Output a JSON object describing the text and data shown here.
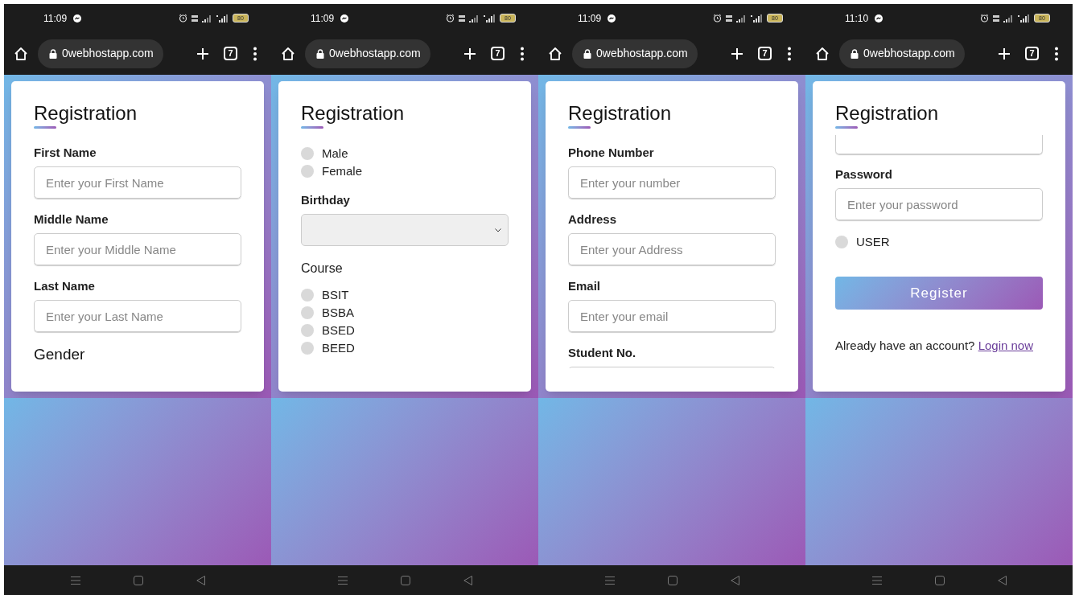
{
  "phones": [
    {
      "status_bar": {
        "time": "11:09",
        "battery": "80"
      },
      "browser": {
        "url": "0webhostapp.com",
        "tab_count": "7"
      },
      "form": {
        "title": "Registration",
        "items": [
          {
            "kind": "field",
            "label": "First Name",
            "placeholder": "Enter your First Name"
          },
          {
            "kind": "field",
            "label": "Middle Name",
            "placeholder": "Enter your Middle Name"
          },
          {
            "kind": "field",
            "label": "Last Name",
            "placeholder": "Enter your Last Name"
          },
          {
            "kind": "section_heading",
            "text": "Gender"
          }
        ]
      }
    },
    {
      "status_bar": {
        "time": "11:09",
        "battery": "80"
      },
      "browser": {
        "url": "0webhostapp.com",
        "tab_count": "7"
      },
      "form": {
        "title": "Registration",
        "items": [
          {
            "kind": "radio",
            "label": "Male",
            "selected": false
          },
          {
            "kind": "radio",
            "label": "Female",
            "selected": false
          },
          {
            "kind": "select",
            "label": "Birthday"
          },
          {
            "kind": "group_label",
            "text": "Course"
          },
          {
            "kind": "radio",
            "label": "BSIT",
            "selected": false
          },
          {
            "kind": "radio",
            "label": "BSBA",
            "selected": false
          },
          {
            "kind": "radio",
            "label": "BSED",
            "selected": false
          },
          {
            "kind": "radio",
            "label": "BEED",
            "selected": false
          }
        ]
      }
    },
    {
      "status_bar": {
        "time": "11:09",
        "battery": "80"
      },
      "browser": {
        "url": "0webhostapp.com",
        "tab_count": "7"
      },
      "form": {
        "title": "Registration",
        "items": [
          {
            "kind": "field",
            "label": "Phone Number",
            "placeholder": "Enter your number"
          },
          {
            "kind": "field",
            "label": "Address",
            "placeholder": "Enter your Address"
          },
          {
            "kind": "field",
            "label": "Email",
            "placeholder": "Enter your email"
          },
          {
            "kind": "field",
            "label": "Student No."
          }
        ]
      }
    },
    {
      "status_bar": {
        "time": "11:10",
        "battery": "80"
      },
      "browser": {
        "url": "0webhostapp.com",
        "tab_count": "7"
      },
      "form": {
        "title": "Registration",
        "items": [
          {
            "kind": "field_end"
          },
          {
            "kind": "field",
            "label": "Password",
            "placeholder": "Enter your password"
          },
          {
            "kind": "radio",
            "label": "USER",
            "selected": false
          },
          {
            "kind": "button",
            "label": "Register"
          },
          {
            "kind": "note",
            "text": "Already have an account?",
            "link": "Login now"
          }
        ]
      }
    }
  ]
}
